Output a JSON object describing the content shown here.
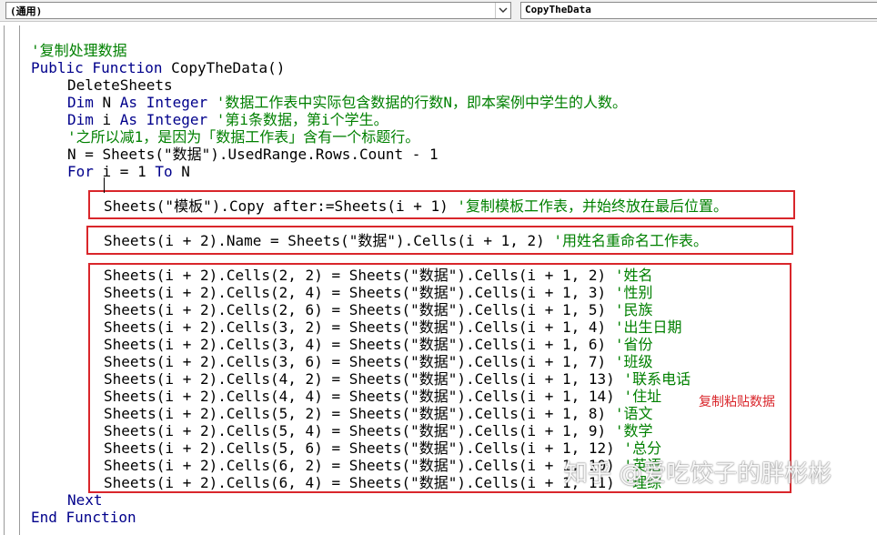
{
  "header": {
    "object_combo": "(通用)",
    "procedure_combo": "CopyTheData"
  },
  "code_lines": [
    {
      "indent": 0,
      "parts": [
        {
          "t": "cm",
          "v": "'复制处理数据"
        }
      ]
    },
    {
      "indent": 0,
      "parts": [
        {
          "t": "kw",
          "v": "Public Function "
        },
        {
          "t": "tx",
          "v": "CopyTheData()"
        }
      ]
    },
    {
      "indent": 1,
      "parts": [
        {
          "t": "tx",
          "v": "DeleteSheets"
        }
      ]
    },
    {
      "indent": 1,
      "parts": [
        {
          "t": "kw",
          "v": "Dim "
        },
        {
          "t": "tx",
          "v": "N "
        },
        {
          "t": "kw",
          "v": "As Integer "
        },
        {
          "t": "cm",
          "v": "'数据工作表中实际包含数据的行数N，即本案例中学生的人数。"
        }
      ]
    },
    {
      "indent": 1,
      "parts": [
        {
          "t": "kw",
          "v": "Dim "
        },
        {
          "t": "tx",
          "v": "i "
        },
        {
          "t": "kw",
          "v": "As Integer "
        },
        {
          "t": "cm",
          "v": "'第i条数据，第i个学生。"
        }
      ]
    },
    {
      "indent": 1,
      "parts": [
        {
          "t": "cm",
          "v": "'之所以减1，是因为「数据工作表」含有一个标题行。"
        }
      ]
    },
    {
      "indent": 1,
      "parts": [
        {
          "t": "tx",
          "v": "N = Sheets(\"数据\").UsedRange.Rows.Count - 1"
        }
      ]
    },
    {
      "indent": 1,
      "parts": [
        {
          "t": "kw",
          "v": "For "
        },
        {
          "t": "tx",
          "v": "i = 1 "
        },
        {
          "t": "kw",
          "v": "To "
        },
        {
          "t": "tx",
          "v": "N"
        }
      ]
    },
    {
      "indent": 2,
      "parts": []
    },
    {
      "indent": 2,
      "parts": [
        {
          "t": "tx",
          "v": "Sheets(\"模板\").Copy after:=Sheets(i + 1) "
        },
        {
          "t": "cm",
          "v": "'复制模板工作表，并始终放在最后位置。"
        }
      ]
    },
    {
      "indent": 2,
      "parts": []
    },
    {
      "indent": 2,
      "parts": [
        {
          "t": "tx",
          "v": "Sheets(i + 2).Name = Sheets(\"数据\").Cells(i + 1, 2) "
        },
        {
          "t": "cm",
          "v": "'用姓名重命名工作表。"
        }
      ]
    },
    {
      "indent": 2,
      "parts": []
    },
    {
      "indent": 2,
      "parts": [
        {
          "t": "tx",
          "v": "Sheets(i + 2).Cells(2, 2) = Sheets(\"数据\").Cells(i + 1, 2) "
        },
        {
          "t": "cm",
          "v": "'姓名"
        }
      ]
    },
    {
      "indent": 2,
      "parts": [
        {
          "t": "tx",
          "v": "Sheets(i + 2).Cells(2, 4) = Sheets(\"数据\").Cells(i + 1, 3) "
        },
        {
          "t": "cm",
          "v": "'性别"
        }
      ]
    },
    {
      "indent": 2,
      "parts": [
        {
          "t": "tx",
          "v": "Sheets(i + 2).Cells(2, 6) = Sheets(\"数据\").Cells(i + 1, 5) "
        },
        {
          "t": "cm",
          "v": "'民族"
        }
      ]
    },
    {
      "indent": 2,
      "parts": [
        {
          "t": "tx",
          "v": "Sheets(i + 2).Cells(3, 2) = Sheets(\"数据\").Cells(i + 1, 4) "
        },
        {
          "t": "cm",
          "v": "'出生日期"
        }
      ]
    },
    {
      "indent": 2,
      "parts": [
        {
          "t": "tx",
          "v": "Sheets(i + 2).Cells(3, 4) = Sheets(\"数据\").Cells(i + 1, 6) "
        },
        {
          "t": "cm",
          "v": "'省份"
        }
      ]
    },
    {
      "indent": 2,
      "parts": [
        {
          "t": "tx",
          "v": "Sheets(i + 2).Cells(3, 6) = Sheets(\"数据\").Cells(i + 1, 7) "
        },
        {
          "t": "cm",
          "v": "'班级"
        }
      ]
    },
    {
      "indent": 2,
      "parts": [
        {
          "t": "tx",
          "v": "Sheets(i + 2).Cells(4, 2) = Sheets(\"数据\").Cells(i + 1, 13) "
        },
        {
          "t": "cm",
          "v": "'联系电话"
        }
      ]
    },
    {
      "indent": 2,
      "parts": [
        {
          "t": "tx",
          "v": "Sheets(i + 2).Cells(4, 4) = Sheets(\"数据\").Cells(i + 1, 14) "
        },
        {
          "t": "cm",
          "v": "'住址"
        }
      ]
    },
    {
      "indent": 2,
      "parts": [
        {
          "t": "tx",
          "v": "Sheets(i + 2).Cells(5, 2) = Sheets(\"数据\").Cells(i + 1, 8) "
        },
        {
          "t": "cm",
          "v": "'语文"
        }
      ]
    },
    {
      "indent": 2,
      "parts": [
        {
          "t": "tx",
          "v": "Sheets(i + 2).Cells(5, 4) = Sheets(\"数据\").Cells(i + 1, 9) "
        },
        {
          "t": "cm",
          "v": "'数学"
        }
      ]
    },
    {
      "indent": 2,
      "parts": [
        {
          "t": "tx",
          "v": "Sheets(i + 2).Cells(5, 6) = Sheets(\"数据\").Cells(i + 1, 12) "
        },
        {
          "t": "cm",
          "v": "'总分"
        }
      ]
    },
    {
      "indent": 2,
      "parts": [
        {
          "t": "tx",
          "v": "Sheets(i + 2).Cells(6, 2) = Sheets(\"数据\").Cells(i + 1, 10) "
        },
        {
          "t": "cm",
          "v": "'英语"
        }
      ]
    },
    {
      "indent": 2,
      "parts": [
        {
          "t": "tx",
          "v": "Sheets(i + 2).Cells(6, 4) = Sheets(\"数据\").Cells(i + 1, 11) "
        },
        {
          "t": "cm",
          "v": "'理综"
        }
      ]
    },
    {
      "indent": 1,
      "parts": [
        {
          "t": "kw",
          "v": "Next"
        }
      ]
    },
    {
      "indent": 0,
      "parts": [
        {
          "t": "kw",
          "v": "End Function"
        }
      ]
    }
  ],
  "annotation": {
    "label": "复制粘贴数据",
    "color": "#d9262b"
  },
  "watermark": "知乎 @爱吃饺子的胖彬彬",
  "colors": {
    "keyword": "#00008b",
    "comment": "#008000",
    "text": "#000000"
  }
}
